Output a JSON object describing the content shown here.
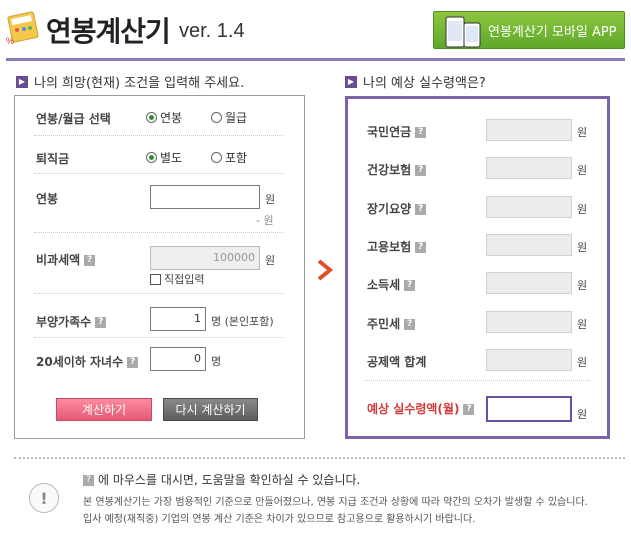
{
  "header": {
    "title": "연봉계산기",
    "version": "ver. 1.4",
    "app_button": "연봉계산기 모바일 APP"
  },
  "left": {
    "heading": "나의 희망(현재) 조건을 입력해 주세요.",
    "salary_type": {
      "label": "연봉/월급 선택",
      "opt1": "연봉",
      "opt2": "월급",
      "selected": "연봉"
    },
    "severance": {
      "label": "퇴직금",
      "opt1": "별도",
      "opt2": "포함",
      "selected": "별도"
    },
    "annual": {
      "label": "연봉",
      "value": "",
      "unit": "원",
      "subtext": "- 원"
    },
    "nontax": {
      "label": "비과세액",
      "value": "100000",
      "unit": "원",
      "check_label": "직접입력"
    },
    "dependents": {
      "label": "부양가족수",
      "value": "1",
      "unit": "명 (본인포함)"
    },
    "children": {
      "label": "20세이하 자녀수",
      "value": "0",
      "unit": "명"
    },
    "calc_button": "계산하기",
    "reset_button": "다시 계산하기"
  },
  "right": {
    "heading": "나의 예상 실수령액은?",
    "rows": [
      {
        "label": "국민연금",
        "help": true,
        "unit": "원"
      },
      {
        "label": "건강보험",
        "help": true,
        "unit": "원"
      },
      {
        "label": "장기요양",
        "help": true,
        "unit": "원"
      },
      {
        "label": "고용보험",
        "help": true,
        "unit": "원"
      },
      {
        "label": "소득세",
        "help": true,
        "unit": "원"
      },
      {
        "label": "주민세",
        "help": true,
        "unit": "원"
      },
      {
        "label": "공제액 합계",
        "help": false,
        "unit": "원"
      }
    ],
    "result_label": "예상 실수령액(월)",
    "result_unit": "원"
  },
  "info": {
    "title": "에 마우스를 대시면, 도움말을 확인하실 수 있습니다.",
    "line1": "본 연봉계산기는 가장 범용적인 기준으로 만들어졌으나, 연봉 지급 조건과 상황에 따라 약간의 오차가 발생할 수 있습니다.",
    "line2": "입사 예정(재직중) 기업의 연봉 계산 기준은 차이가 있으므로 참고용으로 활용하시기 바랍니다."
  },
  "colors": {
    "accent": "#7a63a8",
    "green": "#6cb33f",
    "pink": "#e35a74",
    "result_red": "#d33a3a"
  }
}
